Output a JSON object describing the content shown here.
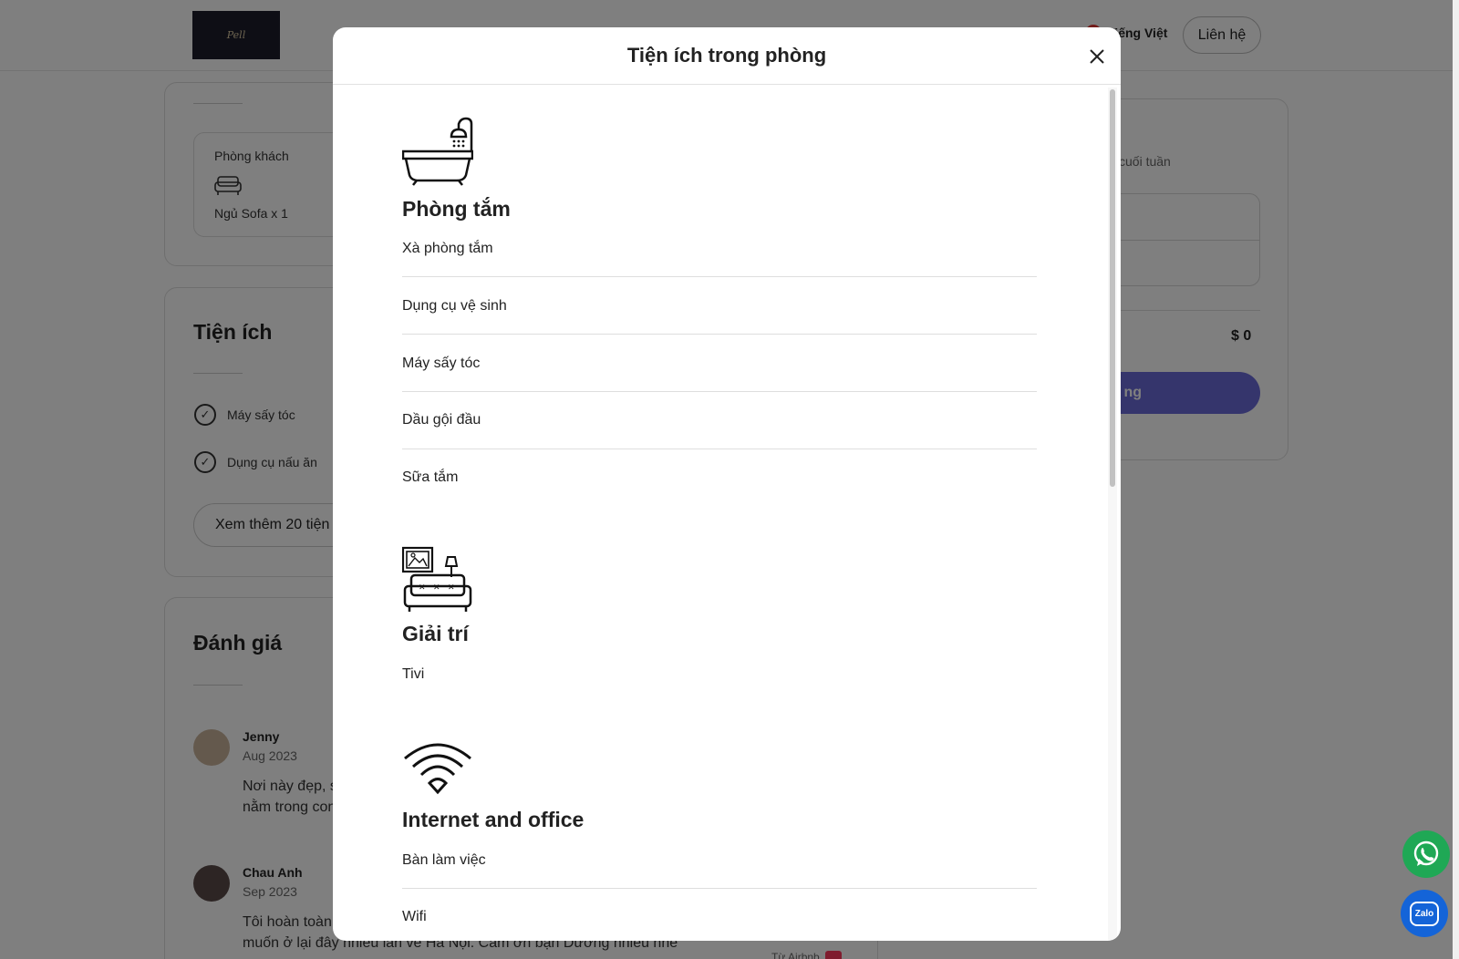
{
  "header": {
    "logo_alt": "Pell Home Suites",
    "language": "Tiếng Việt",
    "contact_label": "Liên hệ"
  },
  "rooms": {
    "room_label": "Phòng khách",
    "bed_label": "Ngủ Sofa x 1"
  },
  "amenities_section": {
    "title": "Tiện ích",
    "items": [
      "Máy sấy tóc",
      "Dụng cụ nấu ăn"
    ],
    "more_button": "Xem thêm 20 tiện"
  },
  "reviews": {
    "title": "Đánh giá",
    "items": [
      {
        "name": "Jenny",
        "date": "Aug 2023",
        "text_line1": "Nơi này đẹp, s",
        "text_line2": "nằm trong con"
      },
      {
        "name": "Chau Anh",
        "date": "Sep 2023",
        "text_line1": "Tôi hoàn toàn",
        "text_line2": "muốn ở lại đây nhiều lần về Hà Nội. Cảm ơn bạn Dương nhiều nhé"
      }
    ],
    "via_label": "Từ Airbnb"
  },
  "booking": {
    "subtitle": "cuối tuần",
    "total": "$ 0",
    "button_label": "ng"
  },
  "modal": {
    "title": "Tiện ích trong phòng",
    "close_icon": "close-icon",
    "categories": [
      {
        "title": "Phòng tắm",
        "icon": "bathtub-icon",
        "items": [
          "Xà phòng tắm",
          "Dụng cụ vệ sinh",
          "Máy sấy tóc",
          "Dầu gội đầu",
          "Sữa tắm"
        ]
      },
      {
        "title": "Giải trí",
        "icon": "living-room-icon",
        "items": [
          "Tivi"
        ]
      },
      {
        "title": "Internet and office",
        "icon": "wifi-icon",
        "items": [
          "Bàn làm việc",
          "Wifi"
        ]
      }
    ]
  },
  "floating": {
    "whatsapp_icon": "whatsapp-icon",
    "zalo_label": "Zalo"
  }
}
